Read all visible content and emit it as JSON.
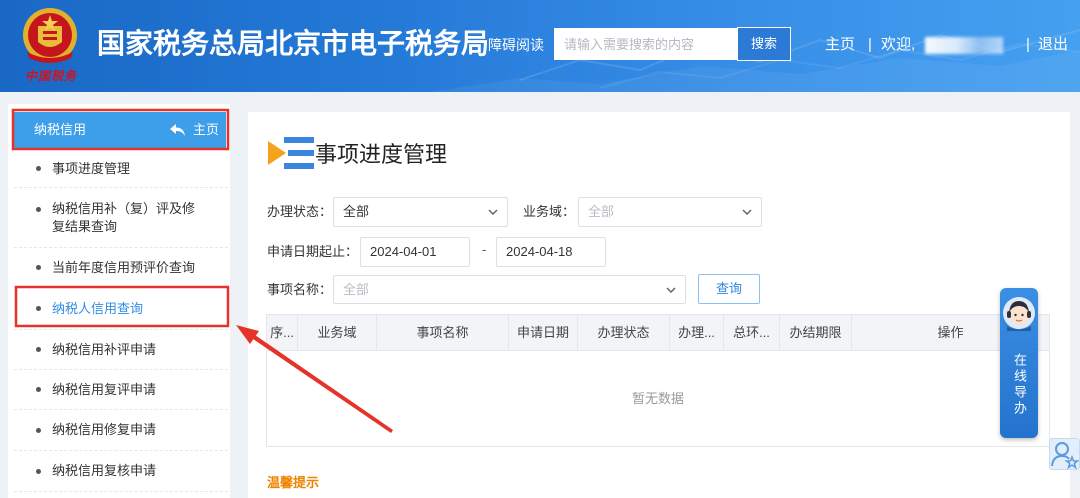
{
  "colors": {
    "header_gradient_start": "#1a68c6",
    "header_gradient_end": "#45a0f0",
    "sidebar_header_bg": "#3d9ee9",
    "active_item_text": "#2e8de6",
    "annotation_red": "#e5332a",
    "tip_orange": "#f08300",
    "guide_blue": "#2f80d8"
  },
  "header": {
    "logo_caption": "中国税务",
    "site_title": "国家税务总局北京市电子税务局",
    "accessibility_link": "障碍阅读",
    "search": {
      "placeholder": "请输入需要搜索的内容",
      "button_label": "搜索"
    },
    "nav": {
      "home": "主页",
      "separator": "|",
      "welcome": "欢迎,",
      "logout": "退出"
    }
  },
  "sidebar": {
    "title": "纳税信用",
    "home_link": "主页",
    "items": [
      {
        "label": "事项进度管理"
      },
      {
        "label": "纳税信用补（复）评及修复结果查询"
      },
      {
        "label": "当前年度信用预评价查询"
      },
      {
        "label": "纳税人信用查询",
        "active": true
      },
      {
        "label": "纳税信用补评申请"
      },
      {
        "label": "纳税信用复评申请"
      },
      {
        "label": "纳税信用修复申请"
      },
      {
        "label": "纳税信用复核申请"
      }
    ]
  },
  "main": {
    "title": "事项进度管理",
    "form": {
      "status": {
        "label": "办理状态：",
        "value": "全部"
      },
      "domain": {
        "label": "业务域：",
        "placeholder": "全部"
      },
      "date_range": {
        "label": "申请日期起止：",
        "start": "2024-04-01",
        "separator": "-",
        "end": "2024-04-18"
      },
      "item_name": {
        "label": "事项名称：",
        "placeholder": "全部"
      },
      "query_button": "查询"
    },
    "table": {
      "columns": [
        "序...",
        "业务域",
        "事项名称",
        "申请日期",
        "办理状态",
        "办理...",
        "总环...",
        "办结期限",
        "操作"
      ],
      "rows": [],
      "empty_text": "暂无数据"
    },
    "tip_title": "温馨提示"
  },
  "guide_widget": {
    "label": "在线导办"
  }
}
